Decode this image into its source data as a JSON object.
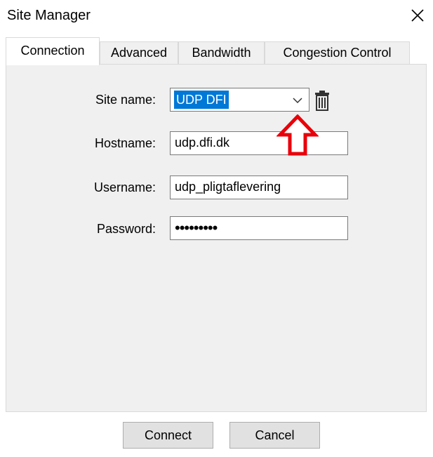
{
  "window": {
    "title": "Site Manager",
    "close_icon": "close-icon"
  },
  "tabs": [
    {
      "label": "Connection",
      "active": true
    },
    {
      "label": "Advanced",
      "active": false
    },
    {
      "label": "Bandwidth",
      "active": false
    },
    {
      "label": "Congestion Control",
      "active": false
    }
  ],
  "form": {
    "site_name": {
      "label": "Site name:",
      "value": "UDP DFI",
      "selected": true
    },
    "hostname": {
      "label": "Hostname:",
      "value": "udp.dfi.dk"
    },
    "username": {
      "label": "Username:",
      "value": "udp_pligtaflevering"
    },
    "password": {
      "label": "Password:",
      "masked_value": "•••••••••"
    }
  },
  "icons": {
    "dropdown": "chevron-down-icon",
    "delete": "trash-icon",
    "annotation": "red-up-arrow-icon"
  },
  "buttons": {
    "connect": "Connect",
    "cancel": "Cancel"
  },
  "colors": {
    "selection": "#0078d7",
    "annotation_arrow": "#e8000b",
    "panel_background": "#f0f0f0"
  }
}
